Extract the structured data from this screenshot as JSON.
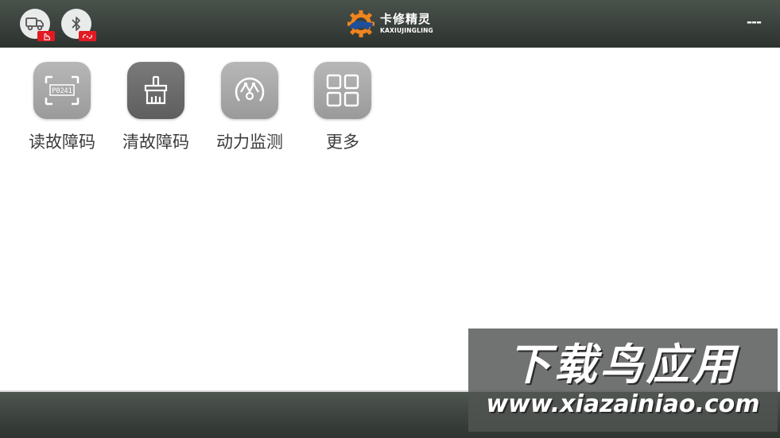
{
  "header": {
    "logo": {
      "name_cn": "卡修精灵",
      "name_en": "KAXIUJINGLING"
    },
    "vehicle_button": {
      "icon": "truck-icon",
      "badge_icon": "hand-tap-icon"
    },
    "bluetooth_button": {
      "icon": "bluetooth-icon",
      "badge_icon": "broken-link-icon"
    },
    "right_text": "---"
  },
  "functions": [
    {
      "label": "读故障码",
      "icon": "scan-code-icon",
      "code_text": "P0241",
      "style": "gray"
    },
    {
      "label": "清故障码",
      "icon": "brush-icon",
      "style": "dark"
    },
    {
      "label": "动力监测",
      "icon": "gauge-icon",
      "style": "gray"
    },
    {
      "label": "更多",
      "icon": "grid-icon",
      "style": "gray"
    }
  ],
  "watermark": {
    "title": "下载鸟应用",
    "url": "www.xiazainiao.com"
  },
  "colors": {
    "bar": "#3a413c",
    "badge": "#e21b23",
    "tile_gray": "#a8a8a8",
    "tile_dark": "#6b6b6b",
    "logo_orange": "#f0841e",
    "logo_blue": "#1f4f9a"
  }
}
